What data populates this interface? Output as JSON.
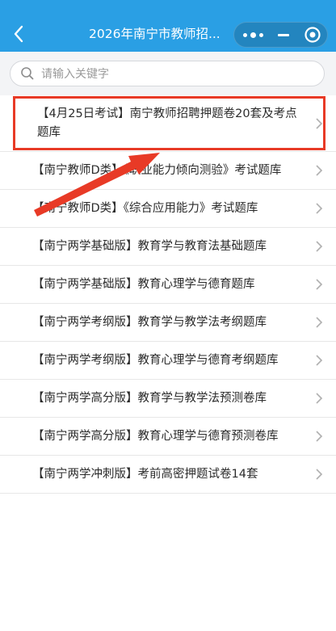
{
  "navbar": {
    "title": "2026年南宁市教师招..."
  },
  "search": {
    "placeholder": "请输入关键字"
  },
  "items": [
    {
      "label": "【4月25日考试】南宁教师招聘押题卷20套及考点题库"
    },
    {
      "label": "【南宁教师D类】《职业能力倾向测验》考试题库"
    },
    {
      "label": "【南宁教师D类】《综合应用能力》考试题库"
    },
    {
      "label": "【南宁两学基础版】教育学与教育法基础题库"
    },
    {
      "label": "【南宁两学基础版】教育心理学与德育题库"
    },
    {
      "label": "【南宁两学考纲版】教育学与教学法考纲题库"
    },
    {
      "label": "【南宁两学考纲版】教育心理学与德育考纲题库"
    },
    {
      "label": "【南宁两学高分版】教育学与教学法预测卷库"
    },
    {
      "label": "【南宁两学高分版】教育心理学与德育预测卷库"
    },
    {
      "label": "【南宁两学冲刺版】考前高密押题试卷14套"
    }
  ],
  "colors": {
    "navbar": "#2a9fe4",
    "highlight": "#e83a26",
    "text": "#2b2b2b"
  }
}
